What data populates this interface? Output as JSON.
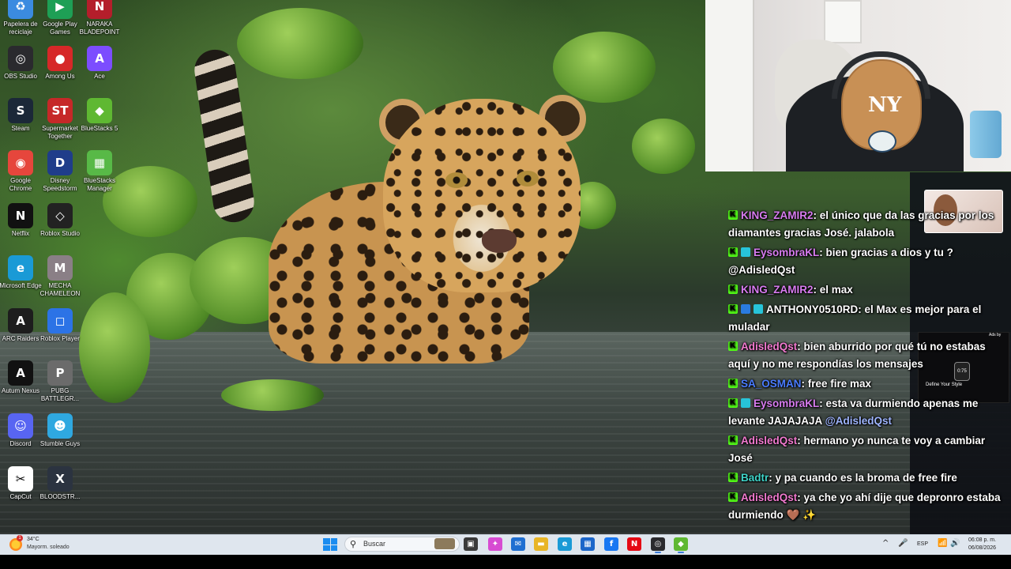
{
  "desktop": {
    "icons": [
      {
        "id": "recycle",
        "label": "Papelera de reciclaje",
        "icon": "recycle-bin-icon",
        "color": "#3b8be0"
      },
      {
        "id": "googleplay",
        "label": "Google Play Games",
        "icon": "google-play-games-icon",
        "color": "#1e9f55"
      },
      {
        "id": "naraka",
        "label": "NARAKA BLADEPOINT",
        "icon": "naraka-icon",
        "color": "#b41e2b"
      },
      {
        "id": "obs",
        "label": "OBS Studio",
        "icon": "obs-icon",
        "color": "#2a2a2e"
      },
      {
        "id": "amongus",
        "label": "Among Us",
        "icon": "among-us-icon",
        "color": "#d62828"
      },
      {
        "id": "ace",
        "label": "Ace",
        "icon": "ace-icon",
        "color": "#7c4dff"
      },
      {
        "id": "steam",
        "label": "Steam",
        "icon": "steam-icon",
        "color": "#1b2838"
      },
      {
        "id": "supermarket",
        "label": "Supermarket Together",
        "icon": "supermarket-together-icon",
        "color": "#c62828"
      },
      {
        "id": "bluestacks5",
        "label": "BlueStacks 5",
        "icon": "bluestacks-icon",
        "color": "#5fb832"
      },
      {
        "id": "chrome",
        "label": "Google Chrome",
        "icon": "chrome-icon",
        "color": "#e6463c"
      },
      {
        "id": "disney",
        "label": "Disney Speedstorm",
        "icon": "disney-speedstorm-icon",
        "color": "#1f3d8a"
      },
      {
        "id": "bsmanager",
        "label": "BlueStacks Manager",
        "icon": "bluestacks-manager-icon",
        "color": "#58b947"
      },
      {
        "id": "netflix",
        "label": "Netflix",
        "icon": "netflix-icon",
        "color": "#111111"
      },
      {
        "id": "robloxstudio",
        "label": "Roblox Studio",
        "icon": "roblox-studio-icon",
        "color": "#222222"
      },
      {
        "id": "mecha",
        "label": "MECHA CHAMELEON",
        "icon": "mecha-chameleon-icon",
        "color": "#8a7f86"
      },
      {
        "id": "edge",
        "label": "Microsoft Edge",
        "icon": "edge-icon",
        "color": "#1a9ad6"
      },
      {
        "id": "arc",
        "label": "ARC Raiders",
        "icon": "arc-raiders-icon",
        "color": "#1d1d1d"
      },
      {
        "id": "robloxplayer",
        "label": "Roblox Player",
        "icon": "roblox-player-icon",
        "color": "#2c73e6"
      },
      {
        "id": "autumn",
        "label": "Autum Nexus",
        "icon": "autum-nexus-icon",
        "color": "#111111"
      },
      {
        "id": "pubg",
        "label": "PUBG BATTLEGR...",
        "icon": "pubg-icon",
        "color": "#6b6b6b"
      },
      {
        "id": "discord",
        "label": "Discord",
        "icon": "discord-icon",
        "color": "#5865f2"
      },
      {
        "id": "stumble",
        "label": "Stumble Guys",
        "icon": "stumble-guys-icon",
        "color": "#2fa8e0"
      },
      {
        "id": "capcut",
        "label": "CapCut",
        "icon": "capcut-icon",
        "color": "#ffffff"
      },
      {
        "id": "bloodstrike",
        "label": "BLOODSTR...",
        "icon": "bloodstrike-icon",
        "color": "#2b3340"
      }
    ],
    "glyphs": {
      "recycle": "♻",
      "googleplay": "▶",
      "naraka": "N",
      "obs": "◎",
      "amongus": "●",
      "ace": "A",
      "steam": "S",
      "supermarket": "ST",
      "bluestacks5": "◆",
      "chrome": "◉",
      "disney": "D",
      "bsmanager": "▦",
      "netflix": "N",
      "robloxstudio": "◇",
      "mecha": "M",
      "edge": "e",
      "arc": "A",
      "robloxplayer": "◻",
      "autumn": "A",
      "pubg": "P",
      "discord": "☺",
      "stumble": "☻",
      "capcut": "✂",
      "bloodstrike": "X"
    }
  },
  "chat": {
    "messages": [
      {
        "badges": [
          "kick"
        ],
        "user": "KING_ZAMIR2",
        "user_color": "#d87cf0",
        "text": ": el único que da las gracias por los diamantes gracias José. jalabola",
        "mention": ""
      },
      {
        "badges": [
          "kick",
          "sub"
        ],
        "user": "EysombraKL",
        "user_color": "#d87cf0",
        "text": ": bien gracias a dios y tu ? @AdisledQst",
        "mention": ""
      },
      {
        "badges": [
          "kick"
        ],
        "user": "KING_ZAMIR2",
        "user_color": "#d87cf0",
        "text": ": el max",
        "mention": ""
      },
      {
        "badges": [
          "kick",
          "vip",
          "sub"
        ],
        "user": "ANTHONY0510RD",
        "user_color": "#ffffff",
        "text": ": el Max es mejor para el muladar",
        "mention": ""
      },
      {
        "badges": [
          "kick"
        ],
        "user": "AdisledQst",
        "user_color": "#f27ad0",
        "text": ": bien aburrido por qué tú no estabas aquí y no me respondías los mensajes",
        "mention": ""
      },
      {
        "badges": [
          "kick"
        ],
        "user": "SA_OSMAN",
        "user_color": "#4a7cff",
        "text": ": free fire max",
        "mention": ""
      },
      {
        "badges": [
          "kick",
          "sub"
        ],
        "user": "EysombraKL",
        "user_color": "#d87cf0",
        "text": ": esta va durmiendo apenas me levante JAJAJAJA ",
        "mention": "@AdisledQst"
      },
      {
        "badges": [
          "kick"
        ],
        "user": "AdisledQst",
        "user_color": "#f27ad0",
        "text": ": hermano yo nunca te voy a cambiar José",
        "mention": ""
      },
      {
        "badges": [
          "kick"
        ],
        "user": "Badtr",
        "user_color": "#3fd4c8",
        "text": ": y pa cuando es la broma de free fire",
        "mention": ""
      },
      {
        "badges": [
          "kick"
        ],
        "user": "AdisledQst",
        "user_color": "#f27ad0",
        "text": ": ya che yo ahí dije que depronro estaba durmiendo 🤎 ✨",
        "mention": ""
      }
    ]
  },
  "webcam": {
    "cap_logo": "NY"
  },
  "ads": {
    "tag": "Ads by",
    "watch_text": "0:75",
    "caption": "Define Your Style"
  },
  "taskbar": {
    "weather": {
      "temp": "34°C",
      "desc": "Mayorm. soleado",
      "badge": "1"
    },
    "search_placeholder": "Buscar",
    "apps": [
      {
        "name": "task-view-icon",
        "glyph": "▣",
        "color": "#3a3a3a"
      },
      {
        "name": "copilot-icon",
        "glyph": "✦",
        "color": "#d74bd2"
      },
      {
        "name": "outlook-icon",
        "glyph": "✉",
        "color": "#1f6fd1"
      },
      {
        "name": "file-explorer-icon",
        "glyph": "▬",
        "color": "#e8b526"
      },
      {
        "name": "edge-icon",
        "glyph": "e",
        "color": "#1a9ad6"
      },
      {
        "name": "store-icon",
        "glyph": "▦",
        "color": "#1c66c9"
      },
      {
        "name": "facebook-icon",
        "glyph": "f",
        "color": "#1877f2"
      },
      {
        "name": "netflix-icon",
        "glyph": "N",
        "color": "#e50914"
      },
      {
        "name": "obs-icon",
        "glyph": "◎",
        "color": "#2a2a2e"
      },
      {
        "name": "bluestacks-icon",
        "glyph": "◆",
        "color": "#5fb832"
      }
    ],
    "tray": {
      "chevron": "^",
      "mic": "🎤",
      "lang": "ESP",
      "wifi": "📶",
      "volume": "🔊"
    },
    "clock": {
      "time": "06:08 p. m.",
      "date": "06/08/2026"
    }
  }
}
